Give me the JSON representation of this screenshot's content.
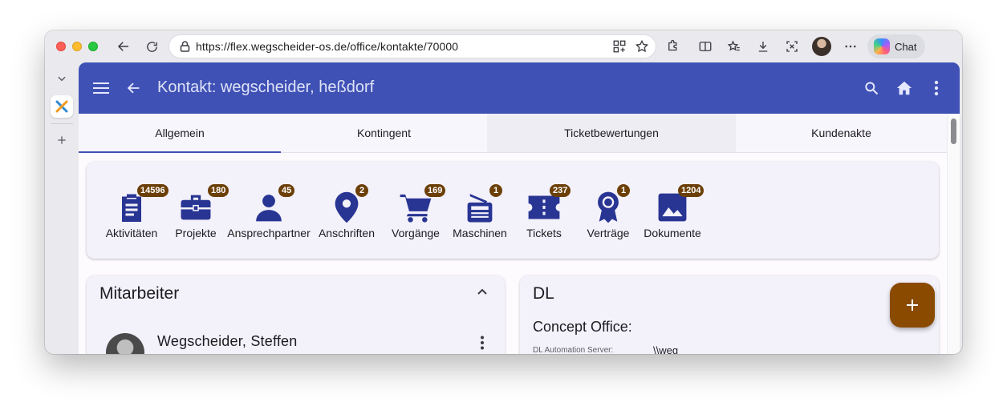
{
  "browser": {
    "url": "https://flex.wegscheider-os.de/office/kontakte/70000",
    "chat_label": "Chat"
  },
  "app": {
    "title": "Kontakt: wegscheider, heßdorf"
  },
  "tabs": [
    {
      "label": "Allgemein"
    },
    {
      "label": "Kontingent"
    },
    {
      "label": "Ticketbewertungen"
    },
    {
      "label": "Kundenakte"
    }
  ],
  "quick_items": [
    {
      "label": "Aktivitäten",
      "count": "14596",
      "icon": "clipboard-icon"
    },
    {
      "label": "Projekte",
      "count": "180",
      "icon": "briefcase-icon"
    },
    {
      "label": "Ansprechpartner",
      "count": "45",
      "icon": "person-icon"
    },
    {
      "label": "Anschriften",
      "count": "2",
      "icon": "location-pin-icon"
    },
    {
      "label": "Vorgänge",
      "count": "169",
      "icon": "shopping-cart-icon"
    },
    {
      "label": "Maschinen",
      "count": "1",
      "icon": "fax-machine-icon"
    },
    {
      "label": "Tickets",
      "count": "237",
      "icon": "ticket-icon"
    },
    {
      "label": "Verträge",
      "count": "1",
      "icon": "award-icon"
    },
    {
      "label": "Dokumente",
      "count": "1204",
      "icon": "image-icon"
    }
  ],
  "employees_card": {
    "title": "Mitarbeiter",
    "employee_name": "Wegscheider, Steffen"
  },
  "dl_card": {
    "title": "DL",
    "subtitle": "Concept Office:",
    "field_label": "DL Automation Server:",
    "field_value": "\\\\weg"
  },
  "colors": {
    "primary": "#3f51b5",
    "badge": "#6b3f06",
    "fab": "#8a4a00",
    "icon": "#283593"
  }
}
